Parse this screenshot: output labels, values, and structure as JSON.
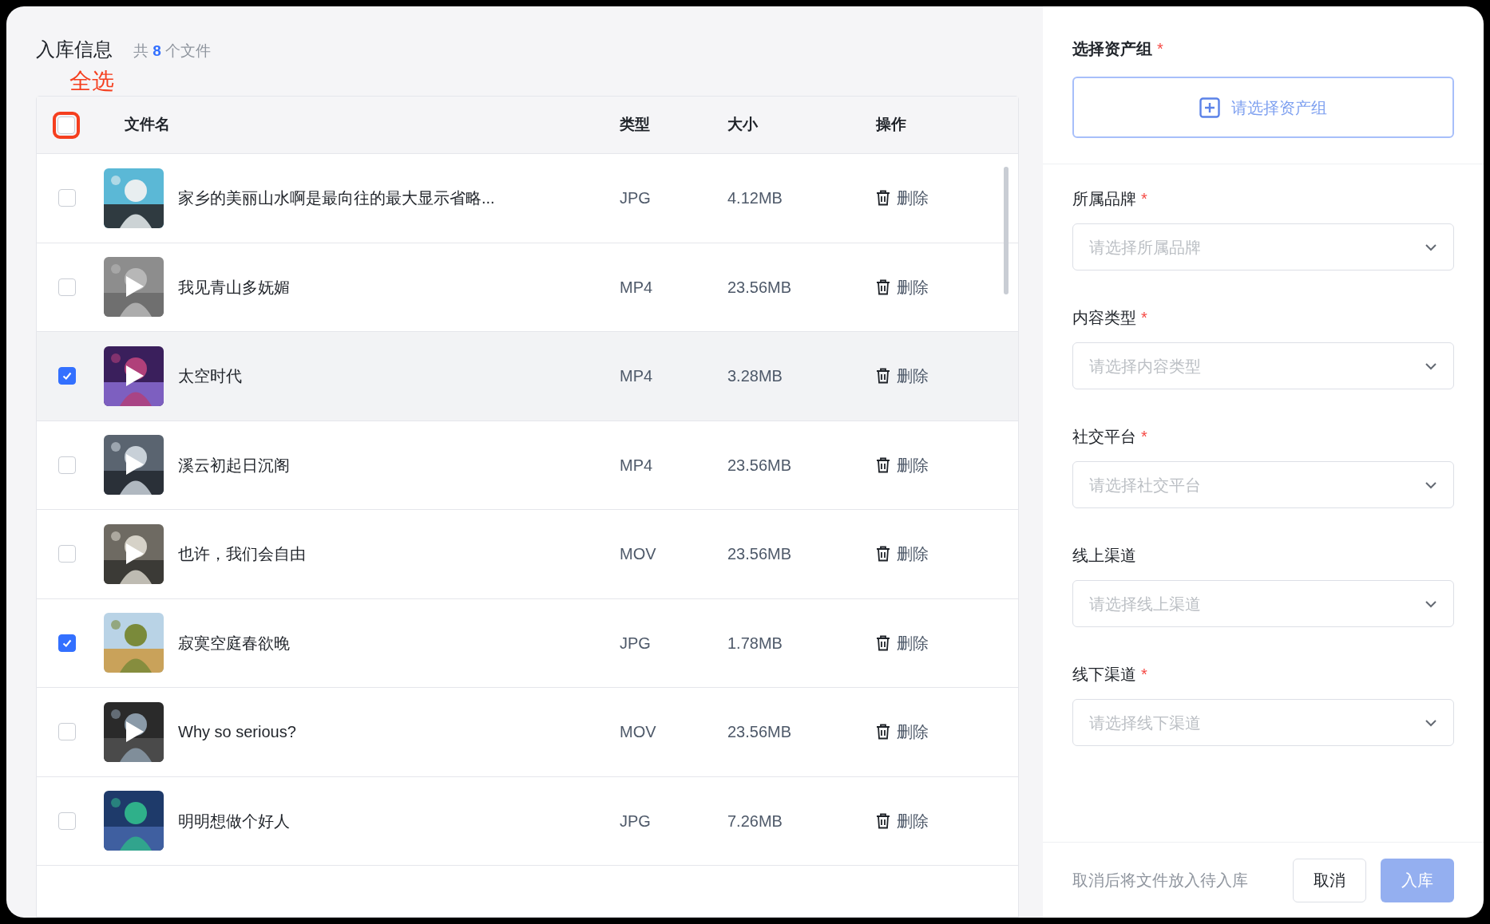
{
  "header": {
    "title": "入库信息",
    "count_prefix": "共",
    "count": "8",
    "count_suffix": "个文件"
  },
  "annotation": {
    "label": "全选"
  },
  "table": {
    "select_all": {
      "checked": false
    },
    "columns": [
      "文件名",
      "类型",
      "大小",
      "操作"
    ],
    "rows": [
      {
        "name": "家乡的美丽山水啊是最向往的最大显示省略...",
        "type": "JPG",
        "size": "4.12MB",
        "action": "删除",
        "checked": false,
        "hovered": false
      },
      {
        "name": "我见青山多妩媚",
        "type": "MP4",
        "size": "23.56MB",
        "action": "删除",
        "kind": "video",
        "checked": false,
        "hovered": false
      },
      {
        "name": "太空时代",
        "type": "MP4",
        "size": "3.28MB",
        "action": "删除",
        "kind": "video",
        "checked": true,
        "hovered": true
      },
      {
        "name": "溪云初起日沉阁",
        "type": "MP4",
        "size": "23.56MB",
        "action": "删除",
        "kind": "video",
        "checked": false,
        "hovered": false
      },
      {
        "name": "也许，我们会自由",
        "type": "MOV",
        "size": "23.56MB",
        "action": "删除",
        "kind": "video",
        "checked": false,
        "hovered": false
      },
      {
        "name": "寂寞空庭春欲晚",
        "type": "JPG",
        "size": "1.78MB",
        "action": "删除",
        "checked": true,
        "hovered": false
      },
      {
        "name": "Why so serious?",
        "type": "MOV",
        "size": "23.56MB",
        "action": "删除",
        "kind": "video",
        "checked": false,
        "hovered": false
      },
      {
        "name": "明明想做个好人",
        "type": "JPG",
        "size": "7.26MB",
        "action": "删除",
        "checked": false,
        "hovered": false
      }
    ]
  },
  "asset_group": {
    "label": "选择资产组",
    "required_mark": "*",
    "button": "请选择资产组"
  },
  "fields": [
    {
      "label": "所属品牌",
      "required_mark": "*",
      "placeholder": "请选择所属品牌"
    },
    {
      "label": "内容类型",
      "required_mark": "*",
      "placeholder": "请选择内容类型"
    },
    {
      "label": "社交平台",
      "required_mark": "*",
      "placeholder": "请选择社交平台"
    },
    {
      "label": "线上渠道",
      "placeholder": "请选择线上渠道"
    },
    {
      "label": "线下渠道",
      "required_mark": "*",
      "placeholder": "请选择线下渠道"
    }
  ],
  "footer": {
    "hint": "取消后将文件放入待入库",
    "cancel": "取消",
    "submit": "入库"
  }
}
